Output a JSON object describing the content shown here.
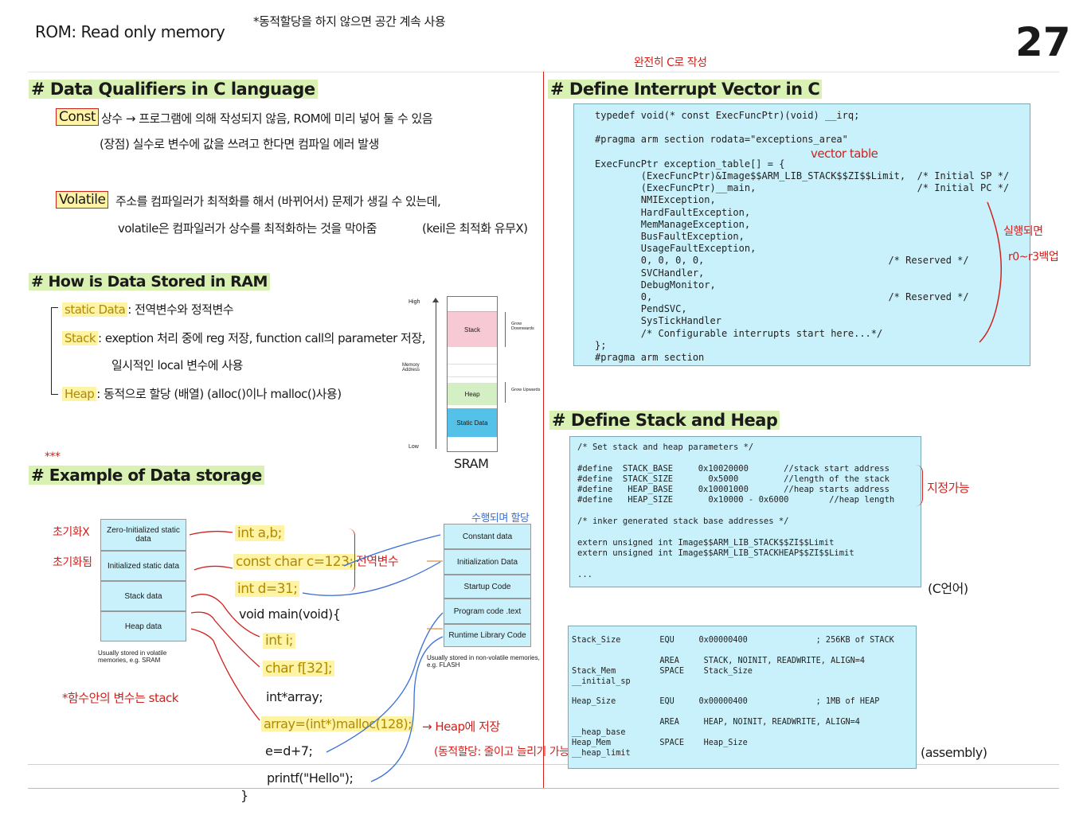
{
  "header": {
    "rom_note": "ROM: Read only memory",
    "top_note": "*동적할당을 하지 않으면 공간 계속 사용",
    "page_number": "27"
  },
  "qualifiers": {
    "title": "# Data Qualifiers in C language",
    "const_label": "Const",
    "const_line1": "상수 → 프로그램에 의해 작성되지 않음, ROM에 미리 넣어 둘 수 있음",
    "const_line2": "(장점) 실수로 변수에 값을 쓰려고 한다면 컴파일 에러 발생",
    "volatile_label": "Volatile",
    "volatile_line1": "주소를 컴파일러가 최적화를 해서 (바뀌어서) 문제가 생길 수 있는데,",
    "volatile_line2": "volatile은 컴파일러가 상수를 최적화하는 것을 막아줌",
    "volatile_note": "(keil은 최적화 유무X)"
  },
  "ram": {
    "title": "# How is Data Stored in RAM",
    "static_label": "static Data",
    "static_text": ": 전역변수와 정적변수",
    "stack_label": "Stack",
    "stack_text": ": exeption 처리 중에 reg 저장, function call의 parameter 저장,",
    "stack_text2": "일시적인 local 변수에 사용",
    "heap_label": "Heap",
    "heap_text": ": 동적으로 할당 (배열)   (alloc()이나 malloc()사용)"
  },
  "sram": {
    "high": "High",
    "low": "Low",
    "memory_address": "Memory Address",
    "stack": "Stack",
    "heap": "Heap",
    "static_data": "Static Data",
    "grow_down": "Grow Downwards",
    "grow_up": "Grow Upwards",
    "caption": "SRAM"
  },
  "example": {
    "stars": "***",
    "title": "# Example of Data storage",
    "left_cells": [
      "Zero-Initialized static data",
      "Initialized static data",
      "Stack data",
      "Heap data"
    ],
    "left_note": "Usually stored in volatile memories, e.g. SRAM",
    "right_cells": [
      "Constant data",
      "Initialization Data",
      "Startup Code",
      "Program code .text",
      "Runtime Library Code"
    ],
    "right_note": "Usually stored in non-volatile memories, e.g. FLASH",
    "right_top_note": "수행되며 할당",
    "no_init": "초기화X",
    "init": "초기화됨",
    "func_note": "*함수안의 변수는 stack",
    "global_note": "전역변수",
    "heap_note": "→ Heap에 저장",
    "heap_note2": "(동적할당: 줄이고 늘리기 가능)",
    "code": [
      "int a,b;",
      "const char c=123;",
      "int d=31;",
      "void main(void){",
      "int i;",
      "char f[32];",
      "int*array;",
      "array=(int*)malloc(128);",
      "e=d+7;",
      "printf(\"Hello\");",
      "}"
    ]
  },
  "interrupt": {
    "annotation": "완전히 C로 작성",
    "title": "# Define Interrupt Vector in C",
    "code": "typedef void(* const ExecFuncPtr)(void) __irq;\n\n#pragma arm section rodata=\"exceptions_area\"\n\nExecFuncPtr exception_table[] = {\n        (ExecFuncPtr)&Image$$ARM_LIB_STACK$$ZI$$Limit,  /* Initial SP */\n        (ExecFuncPtr)__main,                            /* Initial PC */\n        NMIException,\n        HardFaultException,\n        MemManageException,\n        BusFaultException,\n        UsageFaultException,\n        0, 0, 0, 0,                                /* Reserved */\n        SVCHandler,\n        DebugMonitor,\n        0,                                         /* Reserved */\n        PendSVC,\n        SysTickHandler\n        /* Configurable interrupts start here...*/\n};\n#pragma arm section",
    "vector_note": "vector table",
    "side_note1": "실행되면",
    "side_note2": "r0~r3백업"
  },
  "stackheap": {
    "title": "# Define Stack and Heap",
    "c_code": "/* Set stack and heap parameters */\n\n#define  STACK_BASE     0x10020000       //stack start address\n#define  STACK_SIZE       0x5000         //length of the stack\n#define   HEAP_BASE     0x10001000       //heap starts address\n#define   HEAP_SIZE       0x10000 - 0x6000        //heap length\n\n/* inker generated stack base addresses */\n\nextern unsigned int Image$$ARM_LIB_STACK$$ZI$$Limit\nextern unsigned int Image$$ARM_LIB_STACKHEAP$$ZI$$Limit\n\n...",
    "c_note": "(C언어)",
    "assign_note": "지정가능",
    "asm_code": "Stack_Size        EQU     0x00000400              ; 256KB of STACK\n\n                  AREA     STACK, NOINIT, READWRITE, ALIGN=4\nStack_Mem         SPACE    Stack_Size\n__initial_sp\n\nHeap_Size         EQU     0x00000400              ; 1MB of HEAP\n\n                  AREA     HEAP, NOINIT, READWRITE, ALIGN=4\n__heap_base\nHeap_Mem          SPACE    Heap_Size\n__heap_limit",
    "asm_note": "(assembly)"
  }
}
